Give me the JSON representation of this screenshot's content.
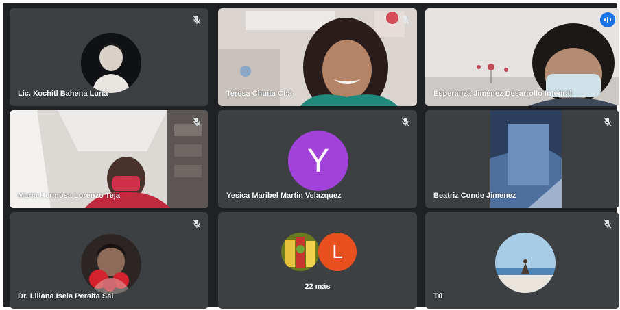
{
  "tiles": [
    {
      "name": "Lic. Xochitl Bahena Luria"
    },
    {
      "name": "Teresa Chuita Cha"
    },
    {
      "name": "Esperanza Jiménez Desarrollo Integral"
    },
    {
      "name": "María Hermosa Lorenzo Teja"
    },
    {
      "name": "Yesica Maribel Martin Velazquez",
      "initial": "Y",
      "color": "#a142d8"
    },
    {
      "name": "Beatriz Conde Jimenez"
    },
    {
      "name": "Dr. Liliana Isela Peralta Sal"
    },
    {
      "name": "22 más",
      "initial": "L",
      "color": "#e8501f"
    },
    {
      "name": "Tú"
    }
  ],
  "colors": {
    "background": "#202124",
    "tile": "#3c4043",
    "active_mic": "#1a73e8"
  },
  "icons": {
    "mic_off": "mic-off-icon",
    "mic_active": "speaking-indicator-icon"
  }
}
